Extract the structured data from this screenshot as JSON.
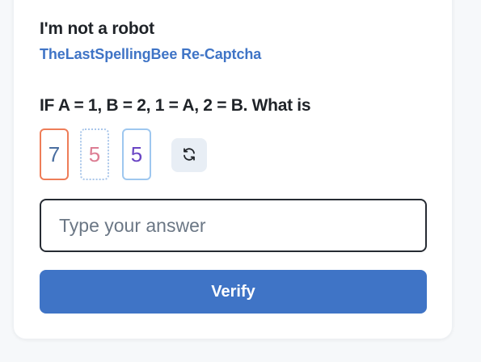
{
  "captcha": {
    "title": "I'm not a robot",
    "subtitle": "TheLastSpellingBee Re-Captcha",
    "question": "IF A = 1, B = 2, 1 = A, 2 = B. What is",
    "digits": [
      "7",
      "5",
      "5"
    ],
    "refresh_icon": "refresh-icon",
    "answer": {
      "value": "",
      "placeholder": "Type your answer"
    },
    "verify_label": "Verify"
  },
  "colors": {
    "accent": "#3f74c6",
    "digit_1_border": "#ee7d58",
    "digit_2_border": "#a9c6ea",
    "digit_3_border": "#9ec7ef"
  }
}
